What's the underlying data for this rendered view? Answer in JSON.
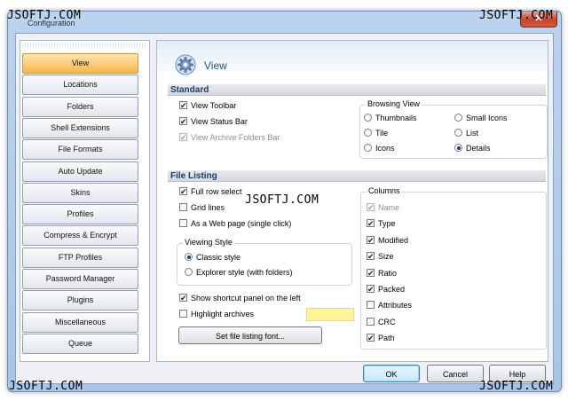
{
  "watermarks": [
    "JSOFTJ.COM",
    "JSOFTJ.COM",
    "JSOFTJ.COM",
    "JSOFTJ.COM",
    "JSOFTJ.COM"
  ],
  "window": {
    "title": "Configuration",
    "close_glyph": "✕"
  },
  "sidebar": {
    "items": [
      {
        "label": "View",
        "active": true
      },
      {
        "label": "Locations"
      },
      {
        "label": "Folders"
      },
      {
        "label": "Shell Extensions"
      },
      {
        "label": "File Formats"
      },
      {
        "label": "Auto Update"
      },
      {
        "label": "Skins"
      },
      {
        "label": "Profiles"
      },
      {
        "label": "Compress & Encrypt"
      },
      {
        "label": "FTP Profiles"
      },
      {
        "label": "Password Manager"
      },
      {
        "label": "Plugins"
      },
      {
        "label": "Miscellaneous"
      },
      {
        "label": "Queue"
      }
    ]
  },
  "page": {
    "title": "View",
    "icon": "gear-icon"
  },
  "standard": {
    "heading": "Standard",
    "options": [
      {
        "label": "View Toolbar",
        "checked": true
      },
      {
        "label": "View Status Bar",
        "checked": true
      },
      {
        "label": "View Archive Folders Bar",
        "checked": true,
        "disabled": true
      }
    ],
    "browsing_view": {
      "title": "Browsing View",
      "options": [
        {
          "label": "Thumbnails",
          "selected": false
        },
        {
          "label": "Small Icons",
          "selected": false
        },
        {
          "label": "Tile",
          "selected": false
        },
        {
          "label": "List",
          "selected": false
        },
        {
          "label": "Icons",
          "selected": false
        },
        {
          "label": "Details",
          "selected": true
        }
      ]
    }
  },
  "file_listing": {
    "heading": "File Listing",
    "options": [
      {
        "label": "Full row select",
        "checked": true
      },
      {
        "label": "Grid lines",
        "checked": false
      },
      {
        "label": "As a Web page (single click)",
        "checked": false
      }
    ],
    "viewing_style": {
      "title": "Viewing Style",
      "options": [
        {
          "label": "Classic style",
          "selected": true
        },
        {
          "label": "Explorer style (with folders)",
          "selected": false
        }
      ]
    },
    "shortcut_panel": {
      "label": "Show shortcut panel on the left",
      "checked": true
    },
    "highlight_archives": {
      "label": "Highlight archives",
      "checked": false,
      "color": "#fff49a"
    },
    "font_button": "Set file listing font...",
    "columns": {
      "title": "Columns",
      "items": [
        {
          "label": "Name",
          "checked": true,
          "disabled": true
        },
        {
          "label": "Type",
          "checked": true
        },
        {
          "label": "Modified",
          "checked": true
        },
        {
          "label": "Size",
          "checked": true
        },
        {
          "label": "Ratio",
          "checked": true
        },
        {
          "label": "Packed",
          "checked": true
        },
        {
          "label": "Attributes",
          "checked": false
        },
        {
          "label": "CRC",
          "checked": false
        },
        {
          "label": "Path",
          "checked": true
        }
      ]
    }
  },
  "footer": {
    "ok": "OK",
    "cancel": "Cancel",
    "help": "Help"
  }
}
